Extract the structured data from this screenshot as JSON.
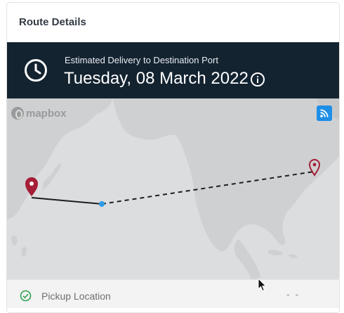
{
  "card": {
    "title": "Route Details"
  },
  "banner": {
    "subtitle": "Estimated Delivery to Destination Port",
    "date": "Tuesday, 08 March 2022",
    "bg_color": "#142330",
    "icon_left": "clock-icon",
    "icon_right": "info-icon"
  },
  "map": {
    "attribution": "mapbox",
    "water_color": "#dcdddf",
    "land_color": "#cfd0d2",
    "origin_pin_color": "#a51d36",
    "destination_pin_color": "#a51d36",
    "current_position_color": "#2e9be6",
    "layer_button_icon": "rss-icon"
  },
  "pickup": {
    "label": "Pickup Location",
    "value": "- -",
    "status_icon": "check-circle-icon",
    "status_color": "#2ea44f"
  }
}
